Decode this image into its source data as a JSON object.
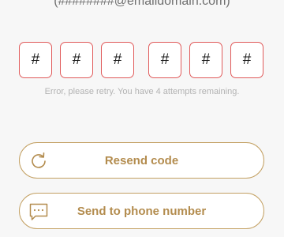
{
  "header": {
    "email_text": "(########@emaildomain.com)"
  },
  "code_inputs": [
    "#",
    "#",
    "#",
    "#",
    "#",
    "#"
  ],
  "status": {
    "error_message": "Error, please retry. You have 4 attempts remaining."
  },
  "actions": {
    "resend_label": "Resend code",
    "resend_icon": "refresh-icon",
    "phone_label": "Send to phone number",
    "phone_icon": "message-icon"
  },
  "colors": {
    "accent": "#b38c4e",
    "border_accent": "#c3a062",
    "error": "#e05a5a",
    "background": "#f7f7f7"
  }
}
